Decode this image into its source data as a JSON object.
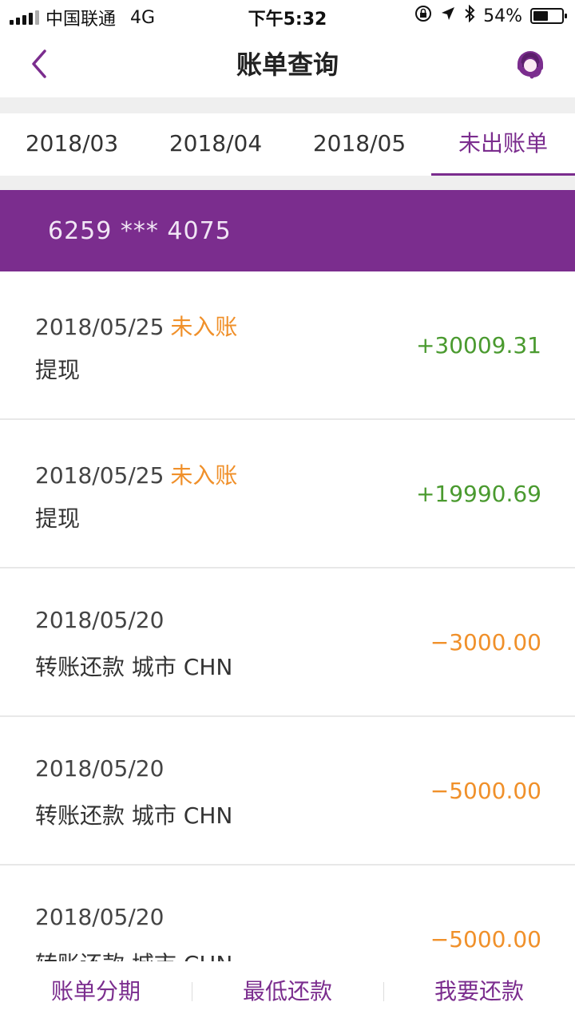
{
  "status": {
    "carrier": "中国联通",
    "network": "4G",
    "time": "下午5:32",
    "battery": "54%",
    "battery_level": 0.54
  },
  "nav": {
    "title": "账单查询"
  },
  "tabs": [
    {
      "label": "2018/03"
    },
    {
      "label": "2018/04"
    },
    {
      "label": "2018/05"
    },
    {
      "label": "未出账单"
    }
  ],
  "card": {
    "number": "6259 *** 4075"
  },
  "transactions": [
    {
      "date": "2018/05/25",
      "status": "未入账",
      "desc": "提现",
      "amount": "+30009.31"
    },
    {
      "date": "2018/05/25",
      "status": "未入账",
      "desc": "提现",
      "amount": "+19990.69"
    },
    {
      "date": "2018/05/20",
      "status": "",
      "desc": "转账还款 城市 CHN",
      "amount": "−3000.00"
    },
    {
      "date": "2018/05/20",
      "status": "",
      "desc": "转账还款 城市 CHN",
      "amount": "−5000.00"
    },
    {
      "date": "2018/05/20",
      "status": "",
      "desc": "转账还款 城市 CHN",
      "amount": "−5000.00"
    }
  ],
  "bottom": {
    "installment": "账单分期",
    "min_payment": "最低还款",
    "repay": "我要还款"
  },
  "colors": {
    "brand": "#7b2d8e",
    "positive": "#4a9a2f",
    "negative": "#f0902a"
  }
}
